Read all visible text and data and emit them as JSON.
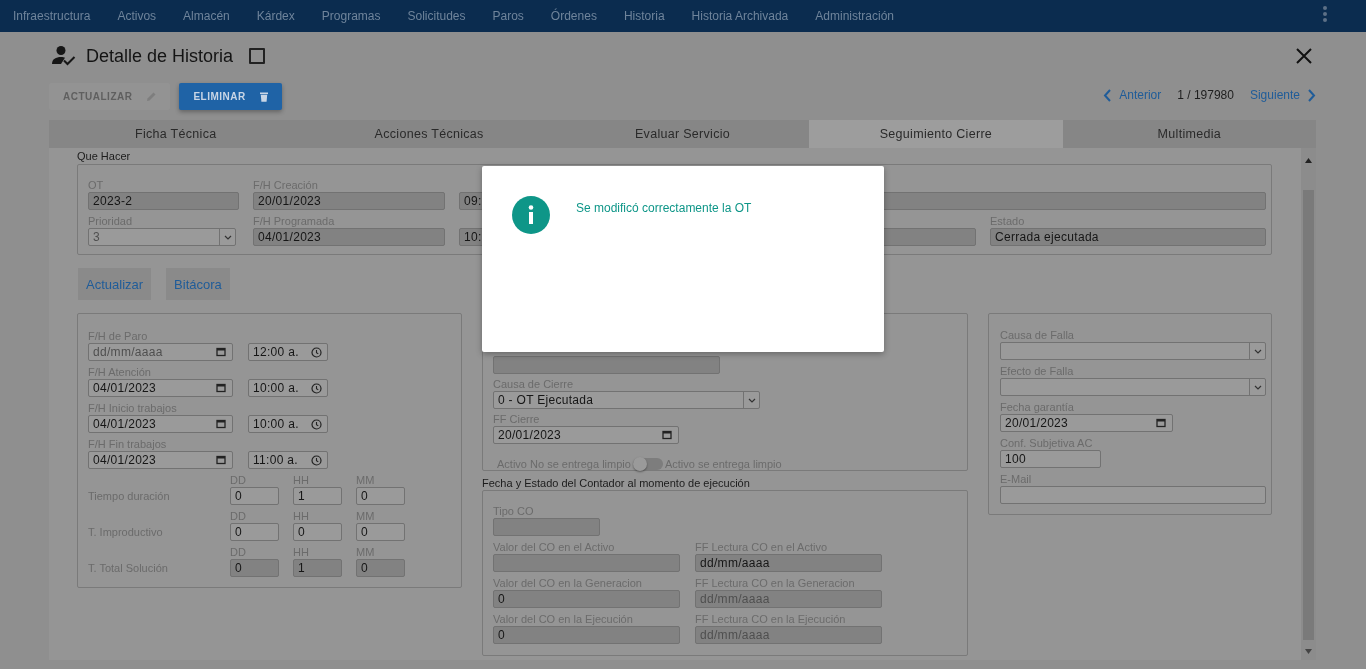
{
  "nav": {
    "items": [
      "Infraestructura",
      "Activos",
      "Almacén",
      "Kárdex",
      "Programas",
      "Solicitudes",
      "Paros",
      "Órdenes",
      "Historia",
      "Historia Archivada",
      "Administración"
    ]
  },
  "header": {
    "title": "Detalle de Historia",
    "checked": false
  },
  "actions": [
    {
      "label": "ACTUALIZAR",
      "kind": "edit",
      "disabled": true
    },
    {
      "label": "ELIMINAR",
      "kind": "delete",
      "disabled": false
    }
  ],
  "pager": {
    "previous": "Anterior",
    "position": "1 / 197980",
    "next": "Siguiente"
  },
  "tabs": [
    {
      "label": "Ficha Técnica",
      "selected": false
    },
    {
      "label": "Acciones Técnicas",
      "selected": false
    },
    {
      "label": "Evaluar Servicio",
      "selected": false
    },
    {
      "label": "Seguimiento Cierre",
      "selected": true
    },
    {
      "label": "Multimedia",
      "selected": false
    }
  ],
  "que_hacer": {
    "legend": "Que Hacer",
    "rows": [
      [
        {
          "label": "OT",
          "kind": "text",
          "value": "2023-2",
          "readonly": true
        },
        {
          "label": "F/H Creación",
          "kind": "text",
          "value": "20/01/2023",
          "readonly": true
        },
        {
          "kind": "text",
          "value": "09:",
          "readonly": true
        },
        {
          "kind": "text",
          "readonly": true
        }
      ],
      [
        {
          "label": "Prioridad",
          "kind": "select",
          "value": "3",
          "readonly": false,
          "disabled": true
        },
        {
          "label": "F/H Programada",
          "kind": "text",
          "value": "04/01/2023",
          "readonly": true
        },
        {
          "kind": "text",
          "value": "10:",
          "readonly": true
        },
        {
          "kind": "text",
          "readonly": true
        },
        {
          "label": "Estado",
          "kind": "text",
          "value": "Cerrada ejecutada",
          "readonly": true
        }
      ]
    ]
  },
  "buttons": [
    "Actualizar",
    "Bitácora"
  ],
  "times": {
    "dates": [
      {
        "label": "F/H de Paro",
        "date": {
          "kind": "date",
          "placeholder": "dd/mm/aaaa",
          "readonly": false
        },
        "time": {
          "kind": "time",
          "value": "12:00 a.",
          "readonly": false
        }
      },
      {
        "label": "F/H Atención",
        "date": {
          "kind": "date",
          "value": "04/01/2023",
          "readonly": false
        },
        "time": {
          "kind": "time",
          "value": "10:00 a.",
          "readonly": false
        }
      },
      {
        "label": "F/H Inicio trabajos",
        "date": {
          "kind": "date",
          "value": "04/01/2023",
          "readonly": false
        },
        "time": {
          "kind": "time",
          "value": "10:00 a.",
          "readonly": false
        }
      },
      {
        "label": "F/H Fin trabajos",
        "date": {
          "kind": "date",
          "value": "04/01/2023",
          "readonly": false
        },
        "time": {
          "kind": "time",
          "value": "11:00 a.",
          "readonly": false
        }
      }
    ],
    "durations": [
      {
        "label": "Tiempo duración",
        "parts": [
          {
            "unit": "DD",
            "value": "0",
            "readonly": false
          },
          {
            "unit": "HH",
            "value": "1",
            "readonly": false
          },
          {
            "unit": "MM",
            "value": "0",
            "readonly": false
          }
        ]
      },
      {
        "label": "T. Improductivo",
        "parts": [
          {
            "unit": "DD",
            "value": "0",
            "readonly": false
          },
          {
            "unit": "HH",
            "value": "0",
            "readonly": false
          },
          {
            "unit": "MM",
            "value": "0",
            "readonly": false
          }
        ]
      },
      {
        "label": "T. Total Solución",
        "parts": [
          {
            "unit": "DD",
            "value": "0",
            "readonly": true
          },
          {
            "unit": "HH",
            "value": "1",
            "readonly": true
          },
          {
            "unit": "MM",
            "value": "0",
            "readonly": true
          }
        ]
      }
    ]
  },
  "cierre": {
    "fields": [
      {
        "kind": "text",
        "readonly": true
      },
      {
        "label": "Causa de Cierre",
        "kind": "select",
        "value": "0 - OT Ejecutada",
        "readonly": false
      },
      {
        "label": "FF Cierre",
        "kind": "date",
        "value": "20/01/2023",
        "readonly": false
      }
    ],
    "toggle": {
      "off_label": "Activo No se entrega limpio",
      "on_label": "Activo se entrega limpio",
      "on": false
    }
  },
  "falla": {
    "fields": [
      {
        "label": "Causa de Falla",
        "kind": "select",
        "readonly": false
      },
      {
        "label": "Efecto de Falla",
        "kind": "select",
        "readonly": false
      },
      {
        "label": "Fecha garantía",
        "kind": "date",
        "value": "20/01/2023",
        "readonly": false
      },
      {
        "label": "Conf. Subjetiva AC",
        "kind": "text",
        "value": "100",
        "readonly": false
      },
      {
        "label": "E-Mail",
        "kind": "text",
        "readonly": false
      }
    ]
  },
  "contador": {
    "legend": "Fecha y Estado del Contador al momento de ejecución",
    "rows": [
      [
        {
          "label": "Tipo CO",
          "kind": "text",
          "readonly": true
        }
      ],
      [
        {
          "label": "Valor del CO en el Activo",
          "kind": "text",
          "readonly": true
        },
        {
          "label": "FF Lectura CO en el Activo",
          "kind": "text",
          "value": "dd/mm/aaaa",
          "readonly": true
        }
      ],
      [
        {
          "label": "Valor del CO en la Generacion",
          "kind": "text",
          "value": "0",
          "readonly": true
        },
        {
          "label": "FF Lectura CO en la Generacion",
          "kind": "text",
          "placeholder": "dd/mm/aaaa",
          "readonly": true
        }
      ],
      [
        {
          "label": "Valor del CO en la Ejecución",
          "kind": "text",
          "value": "0",
          "readonly": true
        },
        {
          "label": "FF Lectura CO en la Ejecución",
          "kind": "text",
          "placeholder": "dd/mm/aaaa",
          "readonly": true
        }
      ]
    ]
  },
  "dialog": {
    "message": "Se modificó correctamente la OT"
  }
}
